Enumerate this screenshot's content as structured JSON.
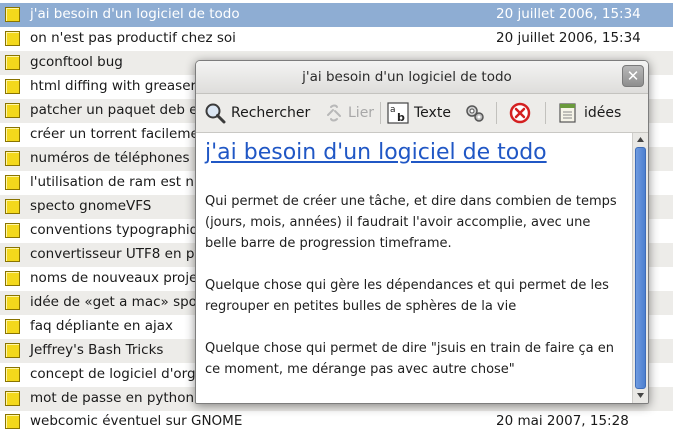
{
  "notes": [
    {
      "title": "j'ai besoin d'un logiciel de todo",
      "date": "20 juillet 2006, 15:34"
    },
    {
      "title": "on n'est pas productif chez soi",
      "date": "20 juillet 2006, 15:34"
    },
    {
      "title": "gconftool bug",
      "date": ""
    },
    {
      "title": "html diffing with greaser",
      "date": ""
    },
    {
      "title": "patcher un paquet deb e",
      "date": ""
    },
    {
      "title": "créer un torrent facileme",
      "date": ""
    },
    {
      "title": "numéros de téléphones",
      "date": ""
    },
    {
      "title": "l'utilisation de ram est n",
      "date": ""
    },
    {
      "title": "specto gnomeVFS",
      "date": ""
    },
    {
      "title": "conventions typographiq",
      "date": ""
    },
    {
      "title": "convertisseur UTF8 en py",
      "date": ""
    },
    {
      "title": "noms de nouveaux proje",
      "date": ""
    },
    {
      "title": "idée de «get a mac» spoo",
      "date": ""
    },
    {
      "title": "faq dépliante en ajax",
      "date": ""
    },
    {
      "title": "Jeffrey's Bash Tricks",
      "date": ""
    },
    {
      "title": "concept de logiciel d'orga",
      "date": ""
    },
    {
      "title": "mot de passe en python",
      "date": ""
    },
    {
      "title": "webcomic éventuel sur GNOME",
      "date": "20 mai 2007, 15:28"
    }
  ],
  "window": {
    "title": "j'ai besoin d'un logiciel de todo",
    "close_glyph": "✕"
  },
  "toolbar": {
    "search_label": "Rechercher",
    "link_label": "Lier",
    "text_label": "Texte",
    "notebook_label": "idées"
  },
  "content": {
    "heading": "j'ai besoin d'un logiciel de todo",
    "paragraphs": [
      "Qui permet de créer une tâche, et dire dans combien de temps (jours, mois, années) il faudrait l'avoir accomplie, avec une belle barre de progression timeframe.",
      "Quelque chose qui gère les dépendances et qui permet de les regrouper en petites bulles de sphères de la vie",
      "Quelque chose qui permet de dire \"jsuis en train de faire ça en ce moment, me dérange pas avec autre chose\""
    ]
  },
  "icons": {
    "note": "note-icon",
    "search": "search-icon",
    "link": "link-icon",
    "text": "text-format-icon",
    "tools": "tools-icon",
    "delete": "delete-icon",
    "notebook": "notebook-icon",
    "close": "close-icon"
  },
  "colors": {
    "selection": "#8eadd3",
    "link": "#2057c5",
    "note_icon": "#f3d81c",
    "delete_red": "#d42020"
  }
}
